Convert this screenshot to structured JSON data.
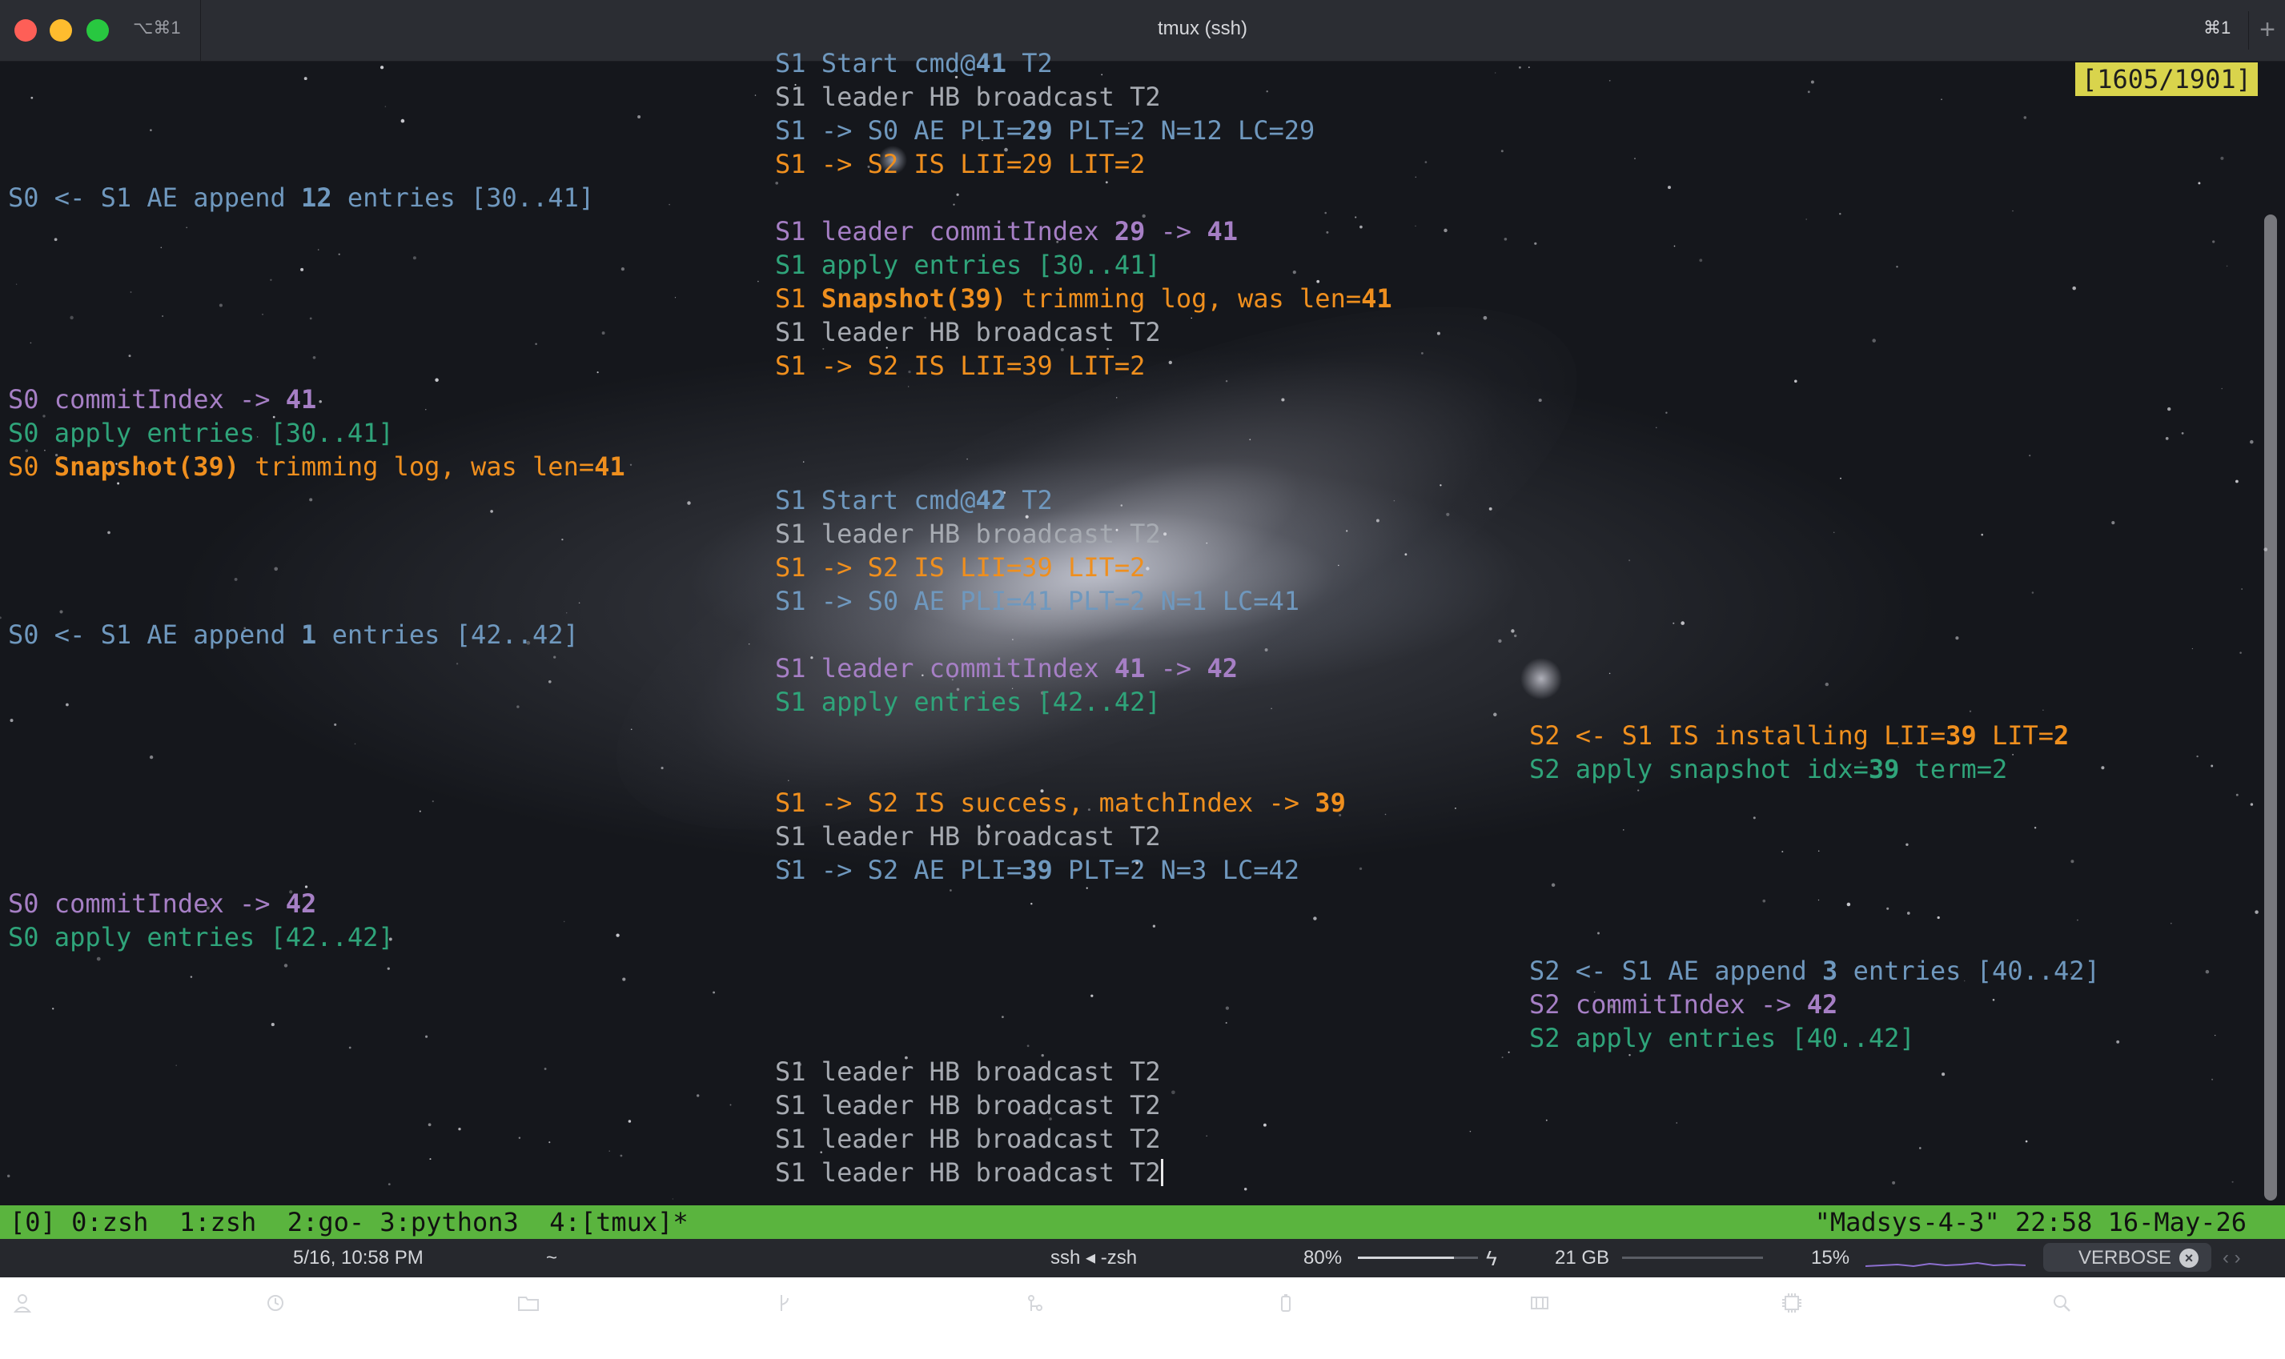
{
  "window": {
    "tab_shortcut": "⌥⌘1",
    "title": "tmux (ssh)",
    "right_shortcut": "⌘1",
    "new_tab_symbol": "+"
  },
  "terminal": {
    "position_indicator": "[1605/1901]",
    "lines": [
      {
        "col": "mid",
        "row": 0,
        "segs": [
          {
            "t": "S1 Start cmd@",
            "c": "blue"
          },
          {
            "t": "41",
            "c": "blue",
            "b": true
          },
          {
            "t": " T2",
            "c": "blue"
          }
        ]
      },
      {
        "col": "mid",
        "row": 1,
        "segs": [
          {
            "t": "S1 leader HB broadcast T2",
            "c": "grey"
          }
        ]
      },
      {
        "col": "mid",
        "row": 2,
        "segs": [
          {
            "t": "S1 -> S0 AE PLI=",
            "c": "blue"
          },
          {
            "t": "29",
            "c": "blue",
            "b": true
          },
          {
            "t": " PLT=2 N=12 LC=29",
            "c": "blue"
          }
        ]
      },
      {
        "col": "mid",
        "row": 3,
        "segs": [
          {
            "t": "S1 -> S2 IS LII=29 LIT=2",
            "c": "orange"
          }
        ]
      },
      {
        "col": "left",
        "row": 4,
        "segs": [
          {
            "t": "S0 <- S1 AE append ",
            "c": "blue"
          },
          {
            "t": "12",
            "c": "blue",
            "b": true
          },
          {
            "t": " entries [30..41]",
            "c": "blue"
          }
        ]
      },
      {
        "col": "mid",
        "row": 5,
        "segs": [
          {
            "t": "S1 leader commitIndex ",
            "c": "purple"
          },
          {
            "t": "29",
            "c": "purple",
            "b": true
          },
          {
            "t": " -> ",
            "c": "purple"
          },
          {
            "t": "41",
            "c": "purple",
            "b": true
          }
        ]
      },
      {
        "col": "mid",
        "row": 6,
        "segs": [
          {
            "t": "S1 apply entries [30..41]",
            "c": "green"
          }
        ]
      },
      {
        "col": "mid",
        "row": 7,
        "segs": [
          {
            "t": "S1 ",
            "c": "orange"
          },
          {
            "t": "Snapshot(39)",
            "c": "orange",
            "b": true
          },
          {
            "t": " trimming log, was len=",
            "c": "orange"
          },
          {
            "t": "41",
            "c": "orange",
            "b": true
          }
        ]
      },
      {
        "col": "mid",
        "row": 8,
        "segs": [
          {
            "t": "S1 leader HB broadcast T2",
            "c": "grey"
          }
        ]
      },
      {
        "col": "mid",
        "row": 9,
        "segs": [
          {
            "t": "S1 -> S2 IS LII=39 LIT=2",
            "c": "orange"
          }
        ]
      },
      {
        "col": "left",
        "row": 10,
        "segs": [
          {
            "t": "S0 commitIndex -> ",
            "c": "purple"
          },
          {
            "t": "41",
            "c": "purple",
            "b": true
          }
        ]
      },
      {
        "col": "left",
        "row": 11,
        "segs": [
          {
            "t": "S0 apply entries [30..41]",
            "c": "green"
          }
        ]
      },
      {
        "col": "left",
        "row": 12,
        "segs": [
          {
            "t": "S0 ",
            "c": "orange"
          },
          {
            "t": "Snapshot(39)",
            "c": "orange",
            "b": true
          },
          {
            "t": " trimming log, was len=",
            "c": "orange"
          },
          {
            "t": "41",
            "c": "orange",
            "b": true
          }
        ]
      },
      {
        "col": "mid",
        "row": 13,
        "segs": [
          {
            "t": "S1 Start cmd@",
            "c": "blue"
          },
          {
            "t": "42",
            "c": "blue",
            "b": true
          },
          {
            "t": " T2",
            "c": "blue"
          }
        ]
      },
      {
        "col": "mid",
        "row": 14,
        "segs": [
          {
            "t": "S1 leader HB broadcast T2",
            "c": "grey"
          }
        ]
      },
      {
        "col": "mid",
        "row": 15,
        "segs": [
          {
            "t": "S1 -> S2 IS LII=39 LIT=2",
            "c": "orange"
          }
        ]
      },
      {
        "col": "mid",
        "row": 16,
        "segs": [
          {
            "t": "S1 -> S0 AE PLI=41 PLT=2 N=1 LC=41",
            "c": "blue"
          }
        ]
      },
      {
        "col": "left",
        "row": 17,
        "segs": [
          {
            "t": "S0 <- S1 AE append ",
            "c": "blue"
          },
          {
            "t": "1",
            "c": "blue",
            "b": true
          },
          {
            "t": " entries [42..42]",
            "c": "blue"
          }
        ]
      },
      {
        "col": "mid",
        "row": 18,
        "segs": [
          {
            "t": "S1 leader commitIndex ",
            "c": "purple"
          },
          {
            "t": "41",
            "c": "purple",
            "b": true
          },
          {
            "t": " -> ",
            "c": "purple"
          },
          {
            "t": "42",
            "c": "purple",
            "b": true
          }
        ]
      },
      {
        "col": "mid",
        "row": 19,
        "segs": [
          {
            "t": "S1 apply entries [42..42]",
            "c": "green"
          }
        ]
      },
      {
        "col": "right",
        "row": 20,
        "segs": [
          {
            "t": "S2 <- S1 IS installing LII=",
            "c": "orange"
          },
          {
            "t": "39",
            "c": "orange",
            "b": true
          },
          {
            "t": " LIT=",
            "c": "orange"
          },
          {
            "t": "2",
            "c": "orange",
            "b": true
          }
        ]
      },
      {
        "col": "right",
        "row": 21,
        "segs": [
          {
            "t": "S2 apply snapshot idx=",
            "c": "green"
          },
          {
            "t": "39",
            "c": "green",
            "b": true
          },
          {
            "t": " term=2",
            "c": "green"
          }
        ]
      },
      {
        "col": "mid",
        "row": 22,
        "segs": [
          {
            "t": "S1 -> S2 IS success, matchIndex -> ",
            "c": "orange"
          },
          {
            "t": "39",
            "c": "orange",
            "b": true
          }
        ]
      },
      {
        "col": "mid",
        "row": 23,
        "segs": [
          {
            "t": "S1 leader HB broadcast T2",
            "c": "grey"
          }
        ]
      },
      {
        "col": "mid",
        "row": 24,
        "segs": [
          {
            "t": "S1 -> S2 AE PLI=",
            "c": "blue"
          },
          {
            "t": "39",
            "c": "blue",
            "b": true
          },
          {
            "t": " PLT=2 N=3 LC=42",
            "c": "blue"
          }
        ]
      },
      {
        "col": "left",
        "row": 25,
        "segs": [
          {
            "t": "S0 commitIndex -> ",
            "c": "purple"
          },
          {
            "t": "42",
            "c": "purple",
            "b": true
          }
        ]
      },
      {
        "col": "left",
        "row": 26,
        "segs": [
          {
            "t": "S0 apply entries [42..42]",
            "c": "green"
          }
        ]
      },
      {
        "col": "right",
        "row": 27,
        "segs": [
          {
            "t": "S2 <- S1 AE append ",
            "c": "blue"
          },
          {
            "t": "3",
            "c": "blue",
            "b": true
          },
          {
            "t": " entries [40..42]",
            "c": "blue"
          }
        ]
      },
      {
        "col": "right",
        "row": 28,
        "segs": [
          {
            "t": "S2 commitIndex -> ",
            "c": "purple"
          },
          {
            "t": "42",
            "c": "purple",
            "b": true
          }
        ]
      },
      {
        "col": "right",
        "row": 29,
        "segs": [
          {
            "t": "S2 apply entries [40..42]",
            "c": "green"
          }
        ]
      },
      {
        "col": "mid",
        "row": 30,
        "segs": [
          {
            "t": "S1 leader HB broadcast T2",
            "c": "grey"
          }
        ]
      },
      {
        "col": "mid",
        "row": 31,
        "segs": [
          {
            "t": "S1 leader HB broadcast T2",
            "c": "grey"
          }
        ]
      },
      {
        "col": "mid",
        "row": 32,
        "segs": [
          {
            "t": "S1 leader HB broadcast T2",
            "c": "grey"
          }
        ]
      },
      {
        "col": "mid",
        "row": 33,
        "segs": [
          {
            "t": "S1 leader HB broadcast T2",
            "c": "grey"
          }
        ],
        "cursor": true
      }
    ]
  },
  "tmux": {
    "left": "[0] 0:zsh  1:zsh  2:go- 3:python3  4:[tmux]*",
    "right": "\"Madsys-4-3\" 22:58 16-May-26"
  },
  "statusbar": {
    "datetime": "5/16, 10:58 PM",
    "directory": "~",
    "session": "ssh ◂ -zsh",
    "battery": "80%",
    "memory": "21 GB",
    "cpu": "15%",
    "search_value": "VERBOSE",
    "battery_level": 0.8,
    "cpu_level": 0.15
  },
  "colors": {
    "grey": "#a7abb2",
    "blue": "#6f98be",
    "purple": "#a67fc5",
    "green": "#2fa47a",
    "orange": "#ef8f1e",
    "tmux_bar": "#5ab43e",
    "indicator": "#d9d44c"
  }
}
